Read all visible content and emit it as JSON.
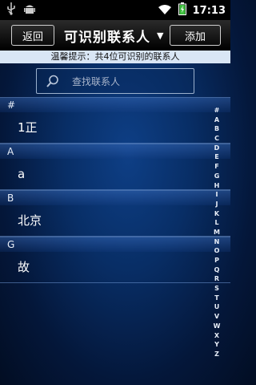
{
  "status_bar": {
    "time": "17:13",
    "icons": [
      "usb-icon",
      "android-icon",
      "wifi-icon",
      "battery-charging-icon"
    ]
  },
  "header": {
    "back_label": "返回",
    "title": "可识别联系人",
    "add_label": "添加"
  },
  "tip": "温馨提示：共4位可识别的联系人",
  "search": {
    "placeholder": "查找联系人"
  },
  "sections": [
    {
      "header": "#",
      "contacts": [
        "1正"
      ]
    },
    {
      "header": "A",
      "contacts": [
        "a"
      ]
    },
    {
      "header": "B",
      "contacts": [
        "北京"
      ]
    },
    {
      "header": "G",
      "contacts": [
        "故"
      ]
    }
  ],
  "index_letters": [
    "#",
    "A",
    "B",
    "C",
    "D",
    "E",
    "F",
    "G",
    "H",
    "I",
    "J",
    "K",
    "L",
    "M",
    "N",
    "O",
    "P",
    "Q",
    "R",
    "S",
    "T",
    "U",
    "V",
    "W",
    "X",
    "Y",
    "Z"
  ]
}
